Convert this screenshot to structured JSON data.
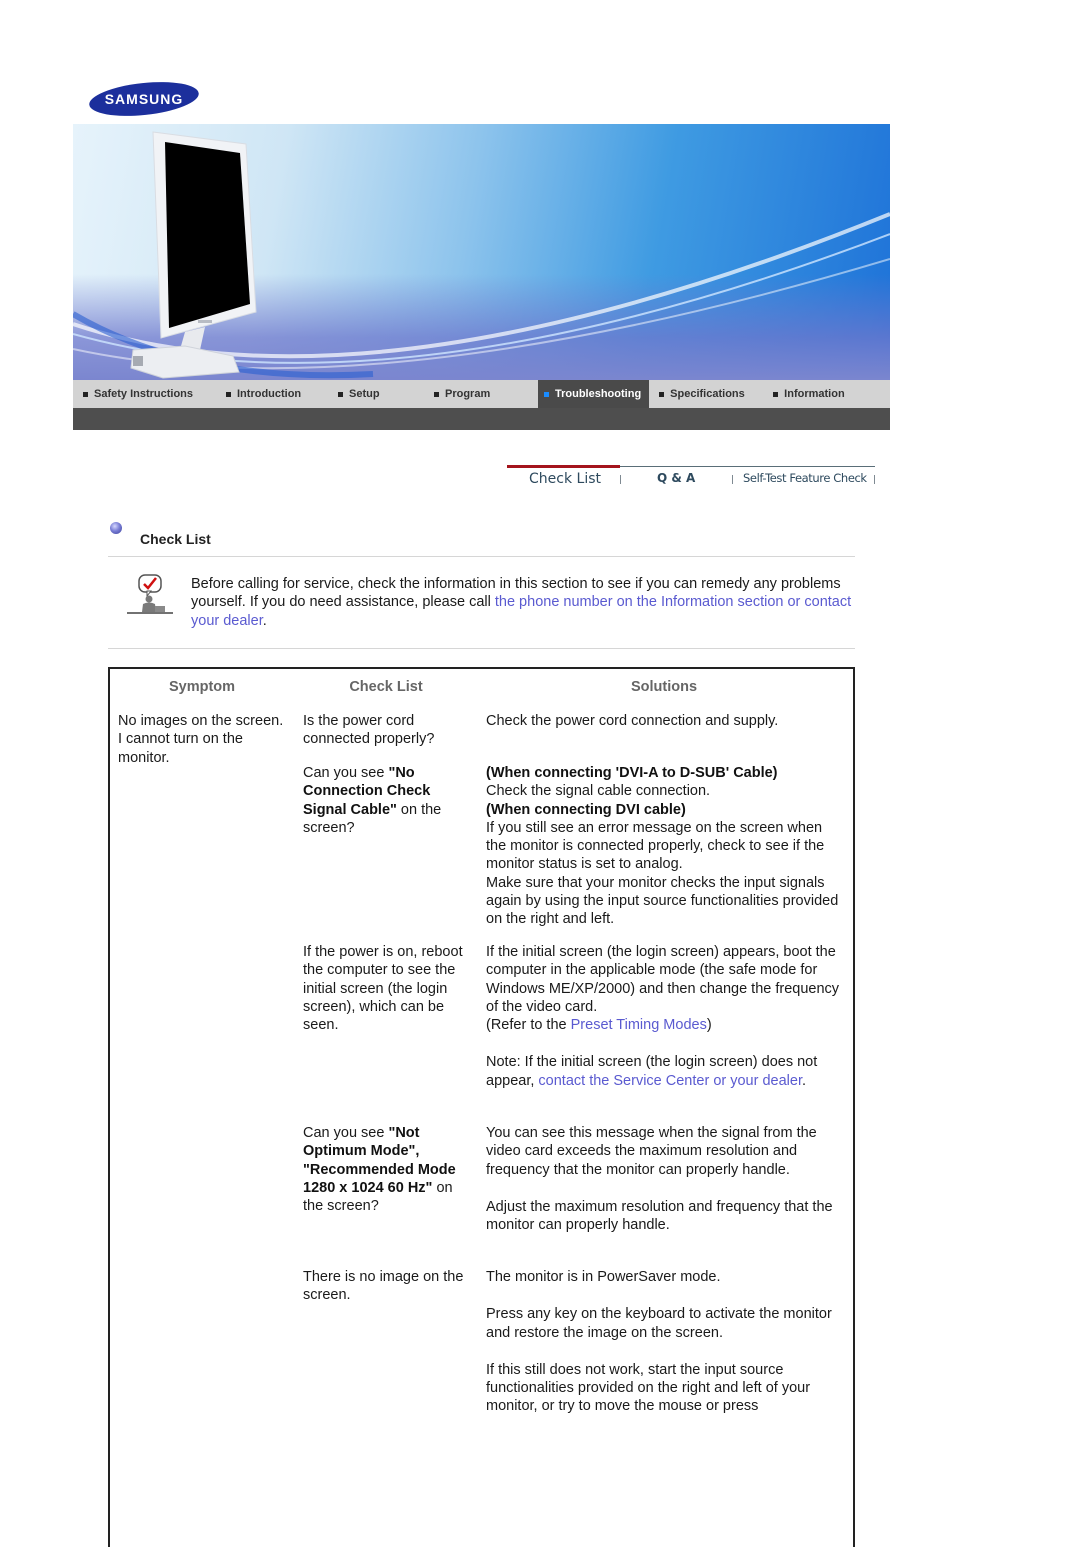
{
  "brand": {
    "logo_text": "SAMSUNG",
    "logo_color": "#1c2f9c"
  },
  "nav": {
    "items": [
      {
        "label": "Safety Instructions",
        "active": false
      },
      {
        "label": "Introduction",
        "active": false
      },
      {
        "label": "Setup",
        "active": false
      },
      {
        "label": "Program",
        "active": false
      },
      {
        "label": "Troubleshooting",
        "active": true
      },
      {
        "label": "Specifications",
        "active": false
      },
      {
        "label": "Information",
        "active": false
      }
    ]
  },
  "subtabs": [
    {
      "label": "Check List",
      "active": true
    },
    {
      "label": "Q & A",
      "active": false
    },
    {
      "label": "Self-Test Feature Check",
      "active": false
    }
  ],
  "section": {
    "title": "Check List"
  },
  "intro": {
    "text_before": "Before calling for service, check the information in this section to see if you can remedy any problems yourself. If you do need assistance, please call ",
    "link": "the phone number on the Information section or contact your dealer",
    "text_after": "."
  },
  "table": {
    "headers": {
      "symptom": "Symptom",
      "checklist": "Check List",
      "solutions": "Solutions"
    },
    "symptom": "No images on the screen. I cannot turn on the monitor.",
    "rows": [
      {
        "check": {
          "plain": "Is the power cord connected properly?"
        },
        "solution": {
          "text": "Check the power cord connection and supply."
        }
      },
      {
        "check": {
          "pre": "Can you see ",
          "bold": "\"No Connection Check Signal Cable\"",
          "post": " on the screen?"
        },
        "solution": {
          "heading1": "(When connecting 'DVI-A to D-SUB' Cable)",
          "text1": "Check the signal cable connection.",
          "heading2": "(When connecting DVI cable)",
          "text2": "If you still see an error message on the screen when the monitor is connected properly, check to see if the monitor status is set to analog.",
          "text3": "Make sure that your monitor checks the input signals again by using the input source functionalities provided on the right and left."
        }
      },
      {
        "check": {
          "plain": "If the power is on, reboot the computer to see the initial screen (the login screen), which can be seen."
        },
        "solution": {
          "text1": "If the initial screen (the login screen) appears, boot the computer in the applicable mode (the safe mode for Windows ME/XP/2000) and then change the frequency of the video card.",
          "ref_pre": "(Refer to the ",
          "ref_link": "Preset Timing Modes",
          "ref_post": ")",
          "note_pre": "Note: If the initial screen (the login screen) does not appear, ",
          "note_link": "contact the Service Center or your dealer",
          "note_post": "."
        }
      },
      {
        "check": {
          "pre": "Can you see ",
          "bold": "\"Not Optimum Mode\", \"Recommended Mode 1280 x 1024 60 Hz\"",
          "post": " on the screen?"
        },
        "solution": {
          "text1": "You can see this message when the signal from the video card exceeds the maximum resolution and frequency that the monitor can properly handle.",
          "text2": "Adjust the maximum resolution and frequency that the monitor can properly handle."
        }
      },
      {
        "check": {
          "plain": "There is no image on the screen."
        },
        "solution": {
          "text1": "The monitor is in PowerSaver mode.",
          "text2": "Press any key on the keyboard to activate the monitor and restore the image on the screen.",
          "text3": "If this still does not work, start the input source functionalities provided on the right and left of your monitor, or try to move the mouse or press"
        }
      }
    ]
  },
  "colors": {
    "link": "#5a5ad0",
    "active_tab_underline": "#a4141c",
    "nav_active_bg": "#4a4a4a"
  }
}
